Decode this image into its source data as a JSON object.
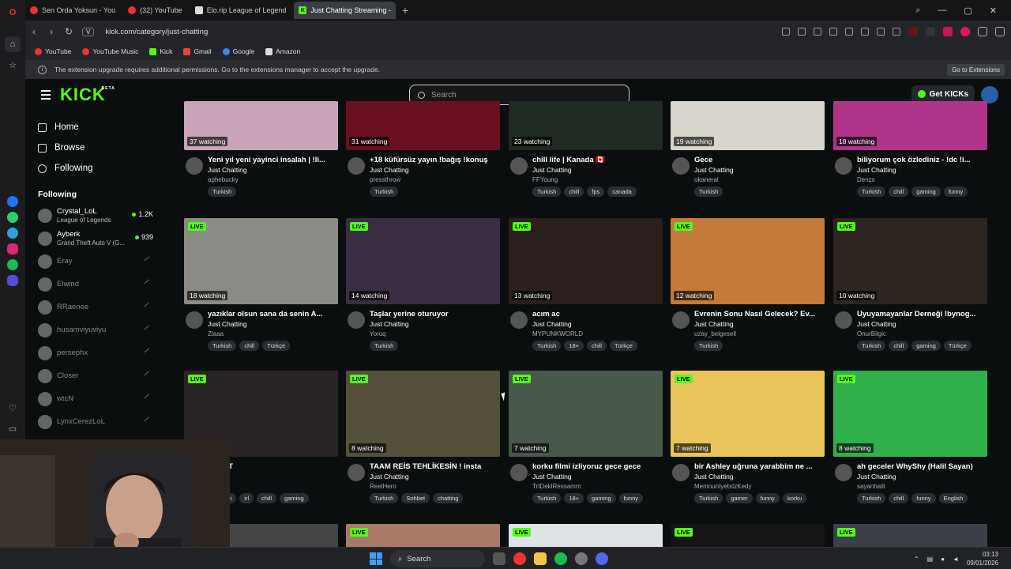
{
  "tabs": [
    {
      "label": "Sen Orda Yoksun - You",
      "color": "#e33"
    },
    {
      "label": "(32) YouTube",
      "color": "#e33"
    },
    {
      "label": "Elo.rip League of Legend",
      "color": "#ddd"
    },
    {
      "label": "Just Chatting Streaming -",
      "color": "#53fc18"
    }
  ],
  "address": {
    "url": "kick.com/category/just-chatting",
    "badge": "V"
  },
  "bookmarks": [
    {
      "label": "YouTube",
      "color": "#e33"
    },
    {
      "label": "YouTube Music",
      "color": "#e33"
    },
    {
      "label": "Kick",
      "color": "#53fc18"
    },
    {
      "label": "Gmail",
      "color": "#ea4335"
    },
    {
      "label": "Google",
      "color": "#4285f4"
    },
    {
      "label": "Amazon",
      "color": "#ddd"
    }
  ],
  "notice": {
    "text": "The extension upgrade requires additional permissions. Go to the extensions manager to accept the upgrade.",
    "button": "Go to Extensions"
  },
  "header": {
    "logo": "KICK",
    "logo_sup": "BETA",
    "search_placeholder": "Search",
    "get_kicks": "Get KICKs"
  },
  "sidebar": {
    "nav": [
      {
        "label": "Home"
      },
      {
        "label": "Browse"
      },
      {
        "label": "Following"
      }
    ],
    "following_title": "Following",
    "channels": [
      {
        "name": "Crystal_LoL",
        "game": "League of Legends",
        "viewers": "1.2K",
        "live": true
      },
      {
        "name": "Ayberk",
        "game": "Grand Theft Auto V (G...",
        "viewers": "939",
        "live": true
      },
      {
        "name": "Eray",
        "live": false
      },
      {
        "name": "Elwind",
        "live": false
      },
      {
        "name": "RRaenee",
        "live": false
      },
      {
        "name": "husamviyuviyu",
        "live": false
      },
      {
        "name": "persephx",
        "live": false
      },
      {
        "name": "Closer",
        "live": false
      },
      {
        "name": "wtcN",
        "live": false
      },
      {
        "name": "LynxCerezLoL",
        "live": false
      }
    ]
  },
  "streams": [
    {
      "watching": "37 watching",
      "title": "Yeni yıl yeni yayinci insalah | !li...",
      "category": "Just Chatting",
      "user": "aphebucky",
      "tags": [
        "Turkish"
      ],
      "live": false,
      "thumb": "#c9a3b8"
    },
    {
      "watching": "31 watching",
      "title": "+18 küfürsüz yayın !bağış !konuş",
      "category": "Just Chatting",
      "user": "pressthrow",
      "tags": [
        "Turkish"
      ],
      "live": false,
      "thumb": "#6b1020"
    },
    {
      "watching": "23 watching",
      "title": "chill life | Kanada 🇨🇦",
      "category": "Just Chatting",
      "user": "FFYoung",
      "tags": [
        "Turkish",
        "chill",
        "fps",
        "canada"
      ],
      "live": false,
      "thumb": "#1f2a22"
    },
    {
      "watching": "19 watching",
      "title": "Gece",
      "category": "Just Chatting",
      "user": "okaneral",
      "tags": [
        "Turkish"
      ],
      "live": false,
      "thumb": "#d8d6cc"
    },
    {
      "watching": "18 watching",
      "title": "biliyorum çok özlediniz - !dc !i...",
      "category": "Just Chatting",
      "user": "Denzs",
      "tags": [
        "Turkish",
        "chill",
        "gaming",
        "funny"
      ],
      "live": false,
      "thumb": "#b0358a"
    },
    {
      "watching": "18 watching",
      "title": "yazıklar olsun sana da senin A...",
      "category": "Just Chatting",
      "user": "Zlaaa",
      "tags": [
        "Turkish",
        "chill",
        "Türkçe"
      ],
      "live": true,
      "thumb": "#8c8a85"
    },
    {
      "watching": "14 watching",
      "title": "Taşlar yerine oturuyor",
      "category": "Just Chatting",
      "user": "Yoruq",
      "tags": [
        "Turkish"
      ],
      "live": true,
      "thumb": "#3a2e45"
    },
    {
      "watching": "13 watching",
      "title": "acım ac",
      "category": "Just Chatting",
      "user": "MYPUNKWORLD",
      "tags": [
        "Turkish",
        "18+",
        "chill",
        "Türkçe"
      ],
      "live": true,
      "thumb": "#2a1f1c"
    },
    {
      "watching": "12 watching",
      "title": "Evrenin Sonu Nasıl Gelecek? Ev...",
      "category": "Just Chatting",
      "user": "uzay_belgesell",
      "tags": [
        "Turkish"
      ],
      "live": true,
      "thumb": "#c47a3a"
    },
    {
      "watching": "10 watching",
      "title": "Uyuyamayanlar Derneği !bynog...",
      "category": "Just Chatting",
      "user": "OnurBilgic",
      "tags": [
        "Turkish",
        "chill",
        "gaming",
        "Türkçe"
      ],
      "live": true,
      "thumb": "#2d2620"
    },
    {
      "watching": "",
      "title": "OCLAT",
      "category": "",
      "user": "",
      "tags": [
        "Turkish",
        "irl",
        "chill",
        "gaming"
      ],
      "live": true,
      "thumb": "#2a2325"
    },
    {
      "watching": "8 watching",
      "title": "TAAM REİS TEHLİKESİN ! insta",
      "category": "Just Chatting",
      "user": "ReelHero",
      "tags": [
        "Turkish",
        "Sohbet",
        "chatting"
      ],
      "live": true,
      "thumb": "#55503a"
    },
    {
      "watching": "7 watching",
      "title": "korku filmi izliyoruz gece gece",
      "category": "Just Chatting",
      "user": "TrtDeklRessamm",
      "tags": [
        "Turkish",
        "18+",
        "gaming",
        "funny"
      ],
      "live": true,
      "thumb": "#48584a"
    },
    {
      "watching": "7 watching",
      "title": "bir Ashley uğruna yarabbim ne ...",
      "category": "Just Chatting",
      "user": "MemnunIyetsIzKedy",
      "tags": [
        "Turkish",
        "gamer",
        "funny",
        "korku"
      ],
      "live": true,
      "thumb": "#e8c45a"
    },
    {
      "watching": "8 watching",
      "title": "ah geceler WhyShy (Halil Sayan)",
      "category": "Just Chatting",
      "user": "sayanhalil",
      "tags": [
        "Turkish",
        "chill",
        "funny",
        "English"
      ],
      "live": true,
      "thumb": "#2fb04a"
    }
  ],
  "taskbar": {
    "search": "Search",
    "time": "03:13",
    "date": "09/01/2026"
  }
}
